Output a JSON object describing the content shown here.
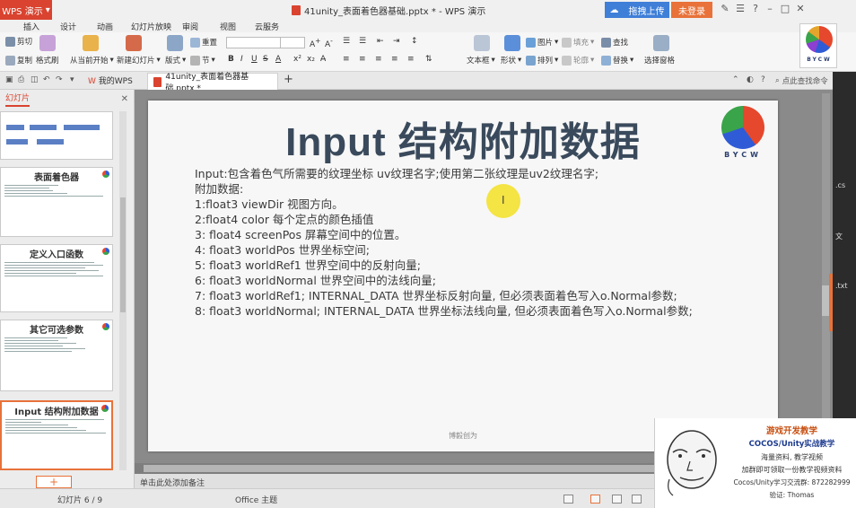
{
  "app": {
    "menu_label": "WPS 演示",
    "doc_title": "41unity_表面着色器基础.pptx * - WPS 演示",
    "share_label": "拖拽上传",
    "login_label": "未登录"
  },
  "menu_tabs": [
    "插入",
    "设计",
    "动画",
    "幻灯片放映",
    "审阅",
    "视图",
    "云服务"
  ],
  "ribbon": {
    "cut": "剪切",
    "copy": "复制",
    "format_painter": "格式刷",
    "from_current": "从当前开始",
    "new_slide": "新建幻灯片",
    "layout": "版式",
    "section": "节",
    "reset": "重置",
    "textbox": "文本框",
    "shape": "形状",
    "picture": "图片",
    "arrange": "排列",
    "fill": "填充",
    "outline": "轮廓",
    "find": "查找",
    "replace": "替换",
    "select_pane": "选择窗格"
  },
  "doc_tabs": {
    "my_wps": "我的WPS",
    "active_doc": "41unity_表面着色器基础.pptx *",
    "search_cmd": "点此查找命令"
  },
  "left_panel": {
    "tab_label": "幻灯片",
    "thumbs": [
      {
        "title": ""
      },
      {
        "title": "表面着色器"
      },
      {
        "title": "定义入口函数"
      },
      {
        "title": "其它可选参数"
      },
      {
        "title": "Input 结构附加数据"
      }
    ],
    "add_label": "+"
  },
  "slide": {
    "title": "Input 结构附加数据",
    "logo_text": "BYCW",
    "lines": [
      "Input:包含着色气所需要的纹理坐标    uv纹理名字;使用第二张纹理是uv2纹理名字;",
      "附加数据:",
      "1:float3 viewDir 视图方向。",
      "2:float4 color 每个定点的颜色插值",
      "3: float4 screenPos 屏幕空间中的位置。",
      "4: float3 worldPos 世界坐标空间;",
      "5: float3 worldRef1 世界空间中的反射向量;",
      "6: float3 worldNormal 世界空间中的法线向量;",
      "7: float3 worldRef1; INTERNAL_DATA 世界坐标反射向量, 但必须表面着色写入o.Normal参数;",
      "8: float3 worldNormal; INTERNAL_DATA 世界坐标法线向量, 但必须表面着色写入o.Normal参数;"
    ],
    "footer": "博毅创为"
  },
  "right_strip": [
    ".cs",
    "文",
    ".txt"
  ],
  "notes_placeholder": "单击此处添加备注",
  "status": {
    "slide_count": "幻灯片 6 / 9",
    "theme": "Office 主题"
  },
  "brand_logo_text": "BYCW",
  "promo": {
    "head": "游戏开发教学",
    "brand": "COCOS/Unity实战教学",
    "l1": "海量资料,  教学视频",
    "l2": "加群即可领取一份教学视频资料",
    "l3": "Cocos/Unity学习交流群: 872282999",
    "l4": "验证: Thomas"
  },
  "colors": {
    "accent": "#d9432f",
    "orange": "#e8723a",
    "title_text": "#3a4a5c",
    "share_blue": "#3f7fd8"
  }
}
